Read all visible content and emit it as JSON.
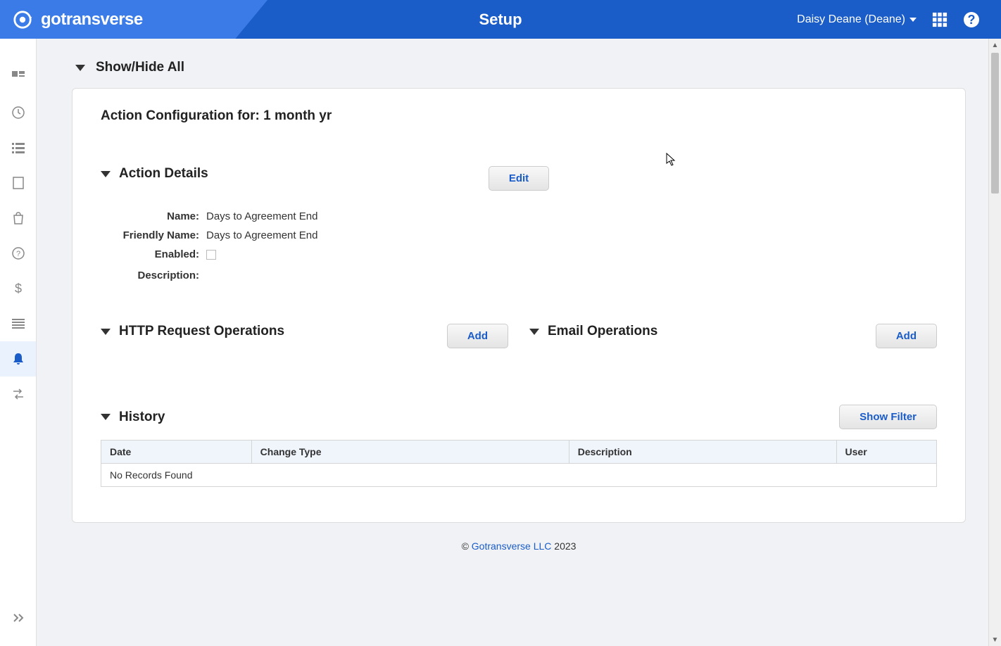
{
  "header": {
    "logo": "gotransverse",
    "title": "Setup",
    "user": "Daisy Deane (Deane)"
  },
  "showHideAll": {
    "label": "Show/Hide All"
  },
  "panel": {
    "title": "Action Configuration for: 1 month yr"
  },
  "actionDetails": {
    "title": "Action Details",
    "editButton": "Edit",
    "fields": {
      "nameLabel": "Name:",
      "nameValue": "Days to Agreement End",
      "friendlyNameLabel": "Friendly Name:",
      "friendlyNameValue": "Days to Agreement End",
      "enabledLabel": "Enabled:",
      "descriptionLabel": "Description:",
      "descriptionValue": ""
    }
  },
  "httpOperations": {
    "title": "HTTP Request Operations",
    "addButton": "Add"
  },
  "emailOperations": {
    "title": "Email Operations",
    "addButton": "Add"
  },
  "history": {
    "title": "History",
    "showFilterButton": "Show Filter",
    "columns": {
      "date": "Date",
      "changeType": "Change Type",
      "description": "Description",
      "user": "User"
    },
    "noRecords": "No Records Found"
  },
  "footer": {
    "copyright": "©",
    "linkText": "Gotransverse LLC",
    "year": "2023"
  }
}
